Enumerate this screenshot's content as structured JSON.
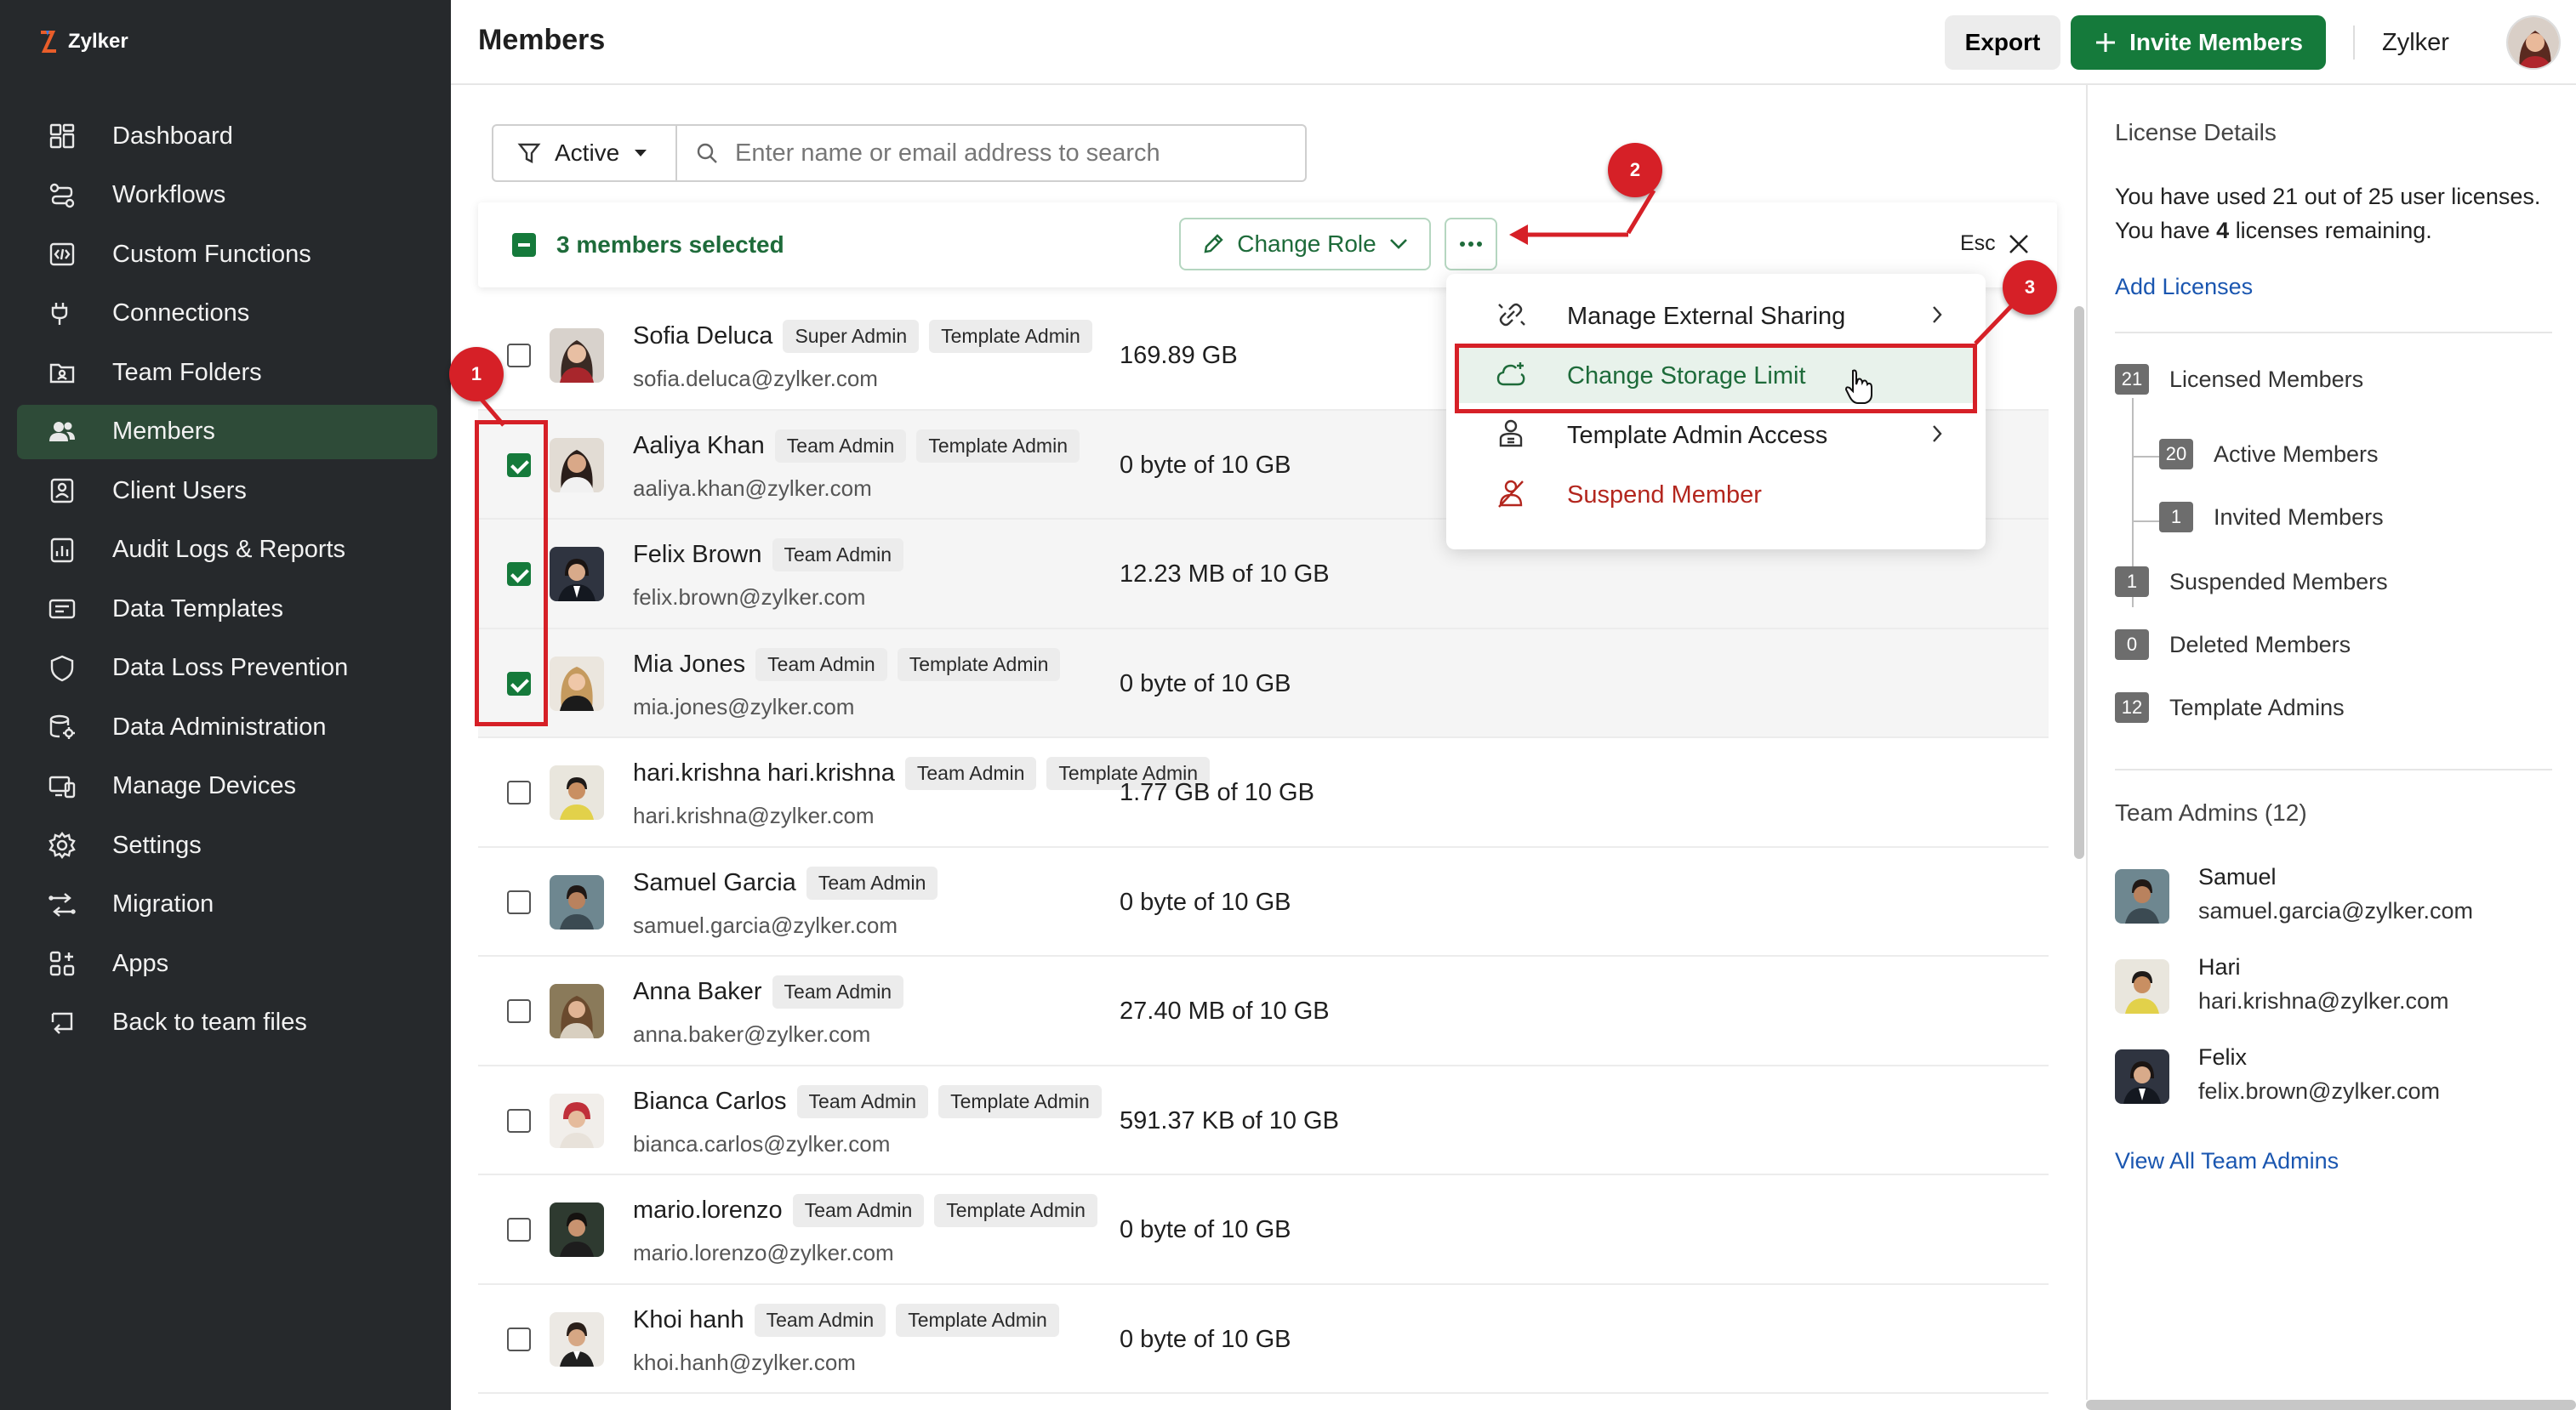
{
  "brand": {
    "name": "Zylker"
  },
  "sidebar": {
    "items": [
      {
        "label": "Dashboard",
        "icon": "dashboard-icon"
      },
      {
        "label": "Workflows",
        "icon": "workflows-icon"
      },
      {
        "label": "Custom Functions",
        "icon": "custom-functions-icon"
      },
      {
        "label": "Connections",
        "icon": "connections-icon"
      },
      {
        "label": "Team Folders",
        "icon": "team-folders-icon"
      },
      {
        "label": "Members",
        "icon": "members-icon",
        "active": true
      },
      {
        "label": "Client Users",
        "icon": "client-users-icon"
      },
      {
        "label": "Audit Logs & Reports",
        "icon": "audit-logs-icon"
      },
      {
        "label": "Data Templates",
        "icon": "data-templates-icon"
      },
      {
        "label": "Data Loss Prevention",
        "icon": "shield-icon"
      },
      {
        "label": "Data Administration",
        "icon": "data-administration-icon"
      },
      {
        "label": "Manage Devices",
        "icon": "devices-icon"
      },
      {
        "label": "Settings",
        "icon": "gear-icon"
      },
      {
        "label": "Migration",
        "icon": "migration-icon"
      },
      {
        "label": "Apps",
        "icon": "apps-icon"
      },
      {
        "label": "Back to team files",
        "icon": "back-icon"
      }
    ]
  },
  "header": {
    "title": "Members",
    "export_label": "Export",
    "invite_label": "Invite Members",
    "org_name": "Zylker"
  },
  "filter": {
    "status_label": "Active",
    "search_placeholder": "Enter name or email address to search"
  },
  "selection": {
    "text": "3 members selected",
    "change_role_label": "Change Role",
    "esc_label": "Esc"
  },
  "menu": {
    "items": [
      {
        "label": "Manage External Sharing",
        "icon": "external-sharing-icon",
        "submenu": true
      },
      {
        "label": "Change Storage Limit",
        "icon": "cloud-add-icon",
        "highlighted": true
      },
      {
        "label": "Template Admin Access",
        "icon": "user-admin-icon",
        "submenu": true
      },
      {
        "label": "Suspend Member",
        "icon": "suspend-user-icon",
        "danger": true
      }
    ]
  },
  "annotations": [
    "1",
    "2",
    "3"
  ],
  "members": [
    {
      "name": "Sofia Deluca",
      "email": "sofia.deluca@zylker.com",
      "tags": [
        "Super Admin",
        "Template Admin"
      ],
      "storage": "169.89 GB",
      "selected": false
    },
    {
      "name": "Aaliya Khan",
      "email": "aaliya.khan@zylker.com",
      "tags": [
        "Team Admin",
        "Template Admin"
      ],
      "storage": "0 byte of 10 GB",
      "selected": true
    },
    {
      "name": "Felix Brown",
      "email": "felix.brown@zylker.com",
      "tags": [
        "Team Admin"
      ],
      "storage": "12.23 MB of 10 GB",
      "selected": true
    },
    {
      "name": "Mia Jones",
      "email": "mia.jones@zylker.com",
      "tags": [
        "Team Admin",
        "Template Admin"
      ],
      "storage": "0 byte of 10 GB",
      "selected": true
    },
    {
      "name": "hari.krishna hari.krishna",
      "email": "hari.krishna@zylker.com",
      "tags": [
        "Team Admin",
        "Template Admin"
      ],
      "storage": "1.77 GB of 10 GB",
      "selected": false
    },
    {
      "name": "Samuel Garcia",
      "email": "samuel.garcia@zylker.com",
      "tags": [
        "Team Admin"
      ],
      "storage": "0 byte of 10 GB",
      "selected": false
    },
    {
      "name": "Anna Baker",
      "email": "anna.baker@zylker.com",
      "tags": [
        "Team Admin"
      ],
      "storage": "27.40 MB of 10 GB",
      "selected": false
    },
    {
      "name": "Bianca Carlos",
      "email": "bianca.carlos@zylker.com",
      "tags": [
        "Team Admin",
        "Template Admin"
      ],
      "storage": "591.37 KB of 10 GB",
      "selected": false
    },
    {
      "name": "mario.lorenzo",
      "email": "mario.lorenzo@zylker.com",
      "tags": [
        "Team Admin",
        "Template Admin"
      ],
      "storage": "0 byte of 10 GB",
      "selected": false
    },
    {
      "name": "Khoi hanh",
      "email": "khoi.hanh@zylker.com",
      "tags": [
        "Team Admin",
        "Template Admin"
      ],
      "storage": "0 byte of 10 GB",
      "selected": false
    }
  ],
  "license": {
    "title": "License Details",
    "used_text": "You have used 21 out of 25 user licenses.",
    "remaining_prefix": "You have",
    "remaining_count": "4",
    "remaining_suffix": "licenses remaining.",
    "add_link": "Add Licenses",
    "stats": {
      "licensed": {
        "count": "21",
        "label": "Licensed Members"
      },
      "active": {
        "count": "20",
        "label": "Active Members"
      },
      "invited": {
        "count": "1",
        "label": "Invited Members"
      },
      "suspended": {
        "count": "1",
        "label": "Suspended Members"
      },
      "deleted": {
        "count": "0",
        "label": "Deleted Members"
      },
      "template_admins": {
        "count": "12",
        "label": "Template Admins"
      }
    }
  },
  "team_admins": {
    "title": "Team Admins (12)",
    "items": [
      {
        "name": "Samuel",
        "email": "samuel.garcia@zylker.com"
      },
      {
        "name": "Hari",
        "email": "hari.krishna@zylker.com"
      },
      {
        "name": "Felix",
        "email": "felix.brown@zylker.com"
      }
    ],
    "view_all": "View All Team Admins"
  },
  "colors": {
    "sidebar_bg": "#26292c",
    "sidebar_active": "#2e4b38",
    "brand_green": "#157a3b",
    "annotation_red": "#d62027",
    "link_blue": "#1a56b0",
    "danger": "#b3261e"
  }
}
